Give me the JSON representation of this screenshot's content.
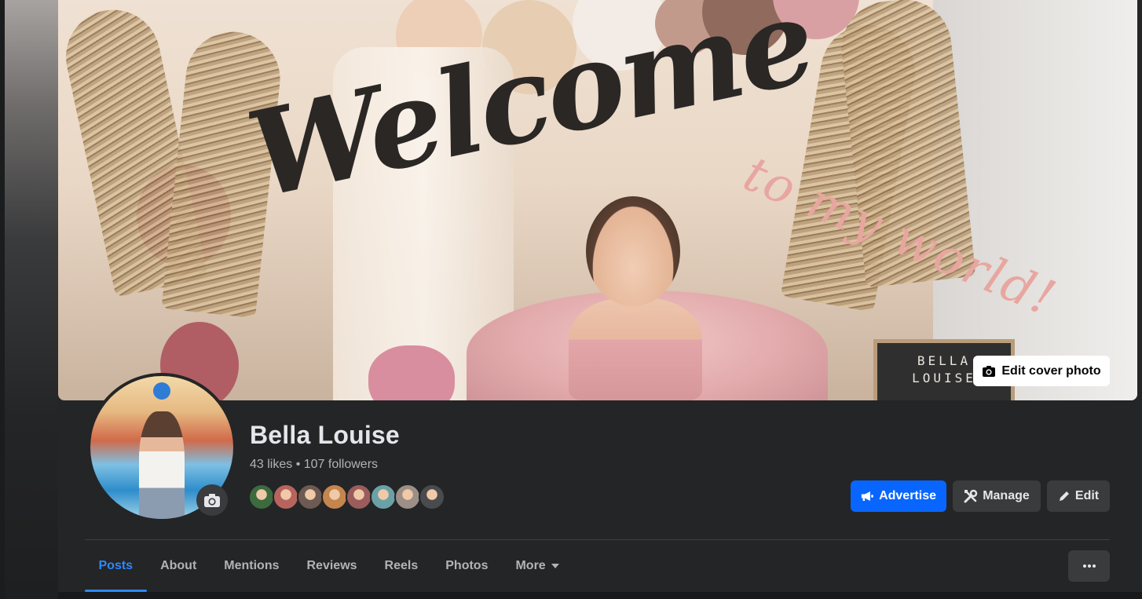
{
  "cover": {
    "edit_cover_label": "Edit cover photo",
    "sign_line1": "BELLA",
    "sign_line2": "LOUISE",
    "headline": "Welcome",
    "tagline": "to my world!"
  },
  "profile": {
    "name": "Bella Louise",
    "stats": "43 likes • 107 followers",
    "friend_avatar_colors": [
      "#3b6b3f",
      "#b8645e",
      "#6d5a52",
      "#c4854e",
      "#9b5c5e",
      "#6aa1a6",
      "#9c8f88",
      "#4a4b4e"
    ]
  },
  "actions": {
    "advertise_label": "Advertise",
    "manage_label": "Manage",
    "edit_label": "Edit"
  },
  "tabs": [
    {
      "label": "Posts",
      "active": true
    },
    {
      "label": "About",
      "active": false
    },
    {
      "label": "Mentions",
      "active": false
    },
    {
      "label": "Reviews",
      "active": false
    },
    {
      "label": "Reels",
      "active": false
    },
    {
      "label": "Photos",
      "active": false
    },
    {
      "label": "More",
      "active": false
    }
  ],
  "colors": {
    "accent": "#0866ff",
    "active_tab": "#2d88ff",
    "panel_bg": "#242526",
    "button_bg": "#3a3b3c"
  },
  "icons": {
    "camera": "camera-icon",
    "megaphone": "megaphone-icon",
    "tools": "tools-icon",
    "pencil": "pencil-icon",
    "caret": "caret-down-icon",
    "ellipsis": "ellipsis-icon"
  }
}
